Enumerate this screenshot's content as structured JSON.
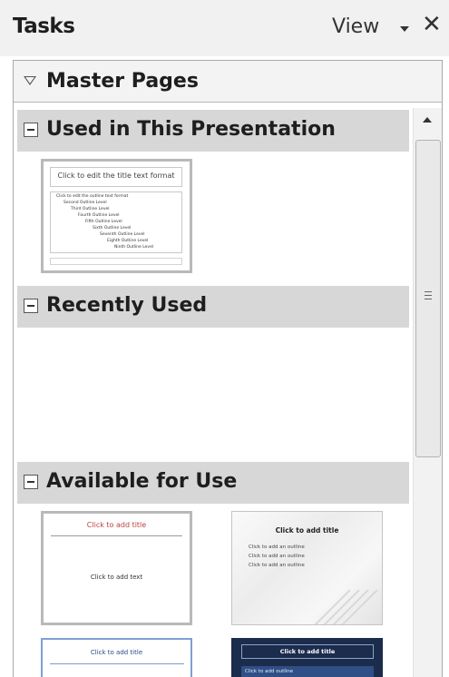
{
  "titlebar": {
    "title": "Tasks",
    "view_label": "View",
    "close_glyph": "✕"
  },
  "master_pages": {
    "label": "Master Pages"
  },
  "sections": {
    "used": {
      "label": "Used in This Presentation"
    },
    "recent": {
      "label": "Recently Used"
    },
    "available": {
      "label": "Available for Use"
    }
  },
  "thumbnails": {
    "used_default": {
      "title": "Click to edit the title text format",
      "outline": [
        "Click to edit the outline text format",
        "Second Outline Level",
        "Third Outline Level",
        "Fourth Outline Level",
        "Fifth Outline Level",
        "Sixth Outline Level",
        "Seventh Outline Level",
        "Eighth Outline Level",
        "Ninth Outline Level"
      ]
    },
    "avail_default": {
      "title": "Click to add title",
      "body": "Click to add text"
    },
    "avail_gray": {
      "title": "Click to add title",
      "bullets": [
        "Click to add an outline",
        "Click to add an outline",
        "Click to add an outline"
      ]
    },
    "avail_blue_border": {
      "title": "Click to add title"
    },
    "avail_dark": {
      "title": "Click to add title",
      "body": "Click to add outline"
    }
  },
  "colors": {
    "section_bg": "#d7d7d7",
    "thumb_border": "#b9b9b9",
    "dark_slide": "#1c2c4c",
    "title_text": "#c04040"
  },
  "icons": {
    "master_pages_toggle": "triangle-down-icon",
    "section_toggle": "collapse-minus-icon",
    "scroll_up": "arrow-up-icon",
    "view_menu": "dropdown-arrow-icon",
    "close": "close-icon"
  }
}
